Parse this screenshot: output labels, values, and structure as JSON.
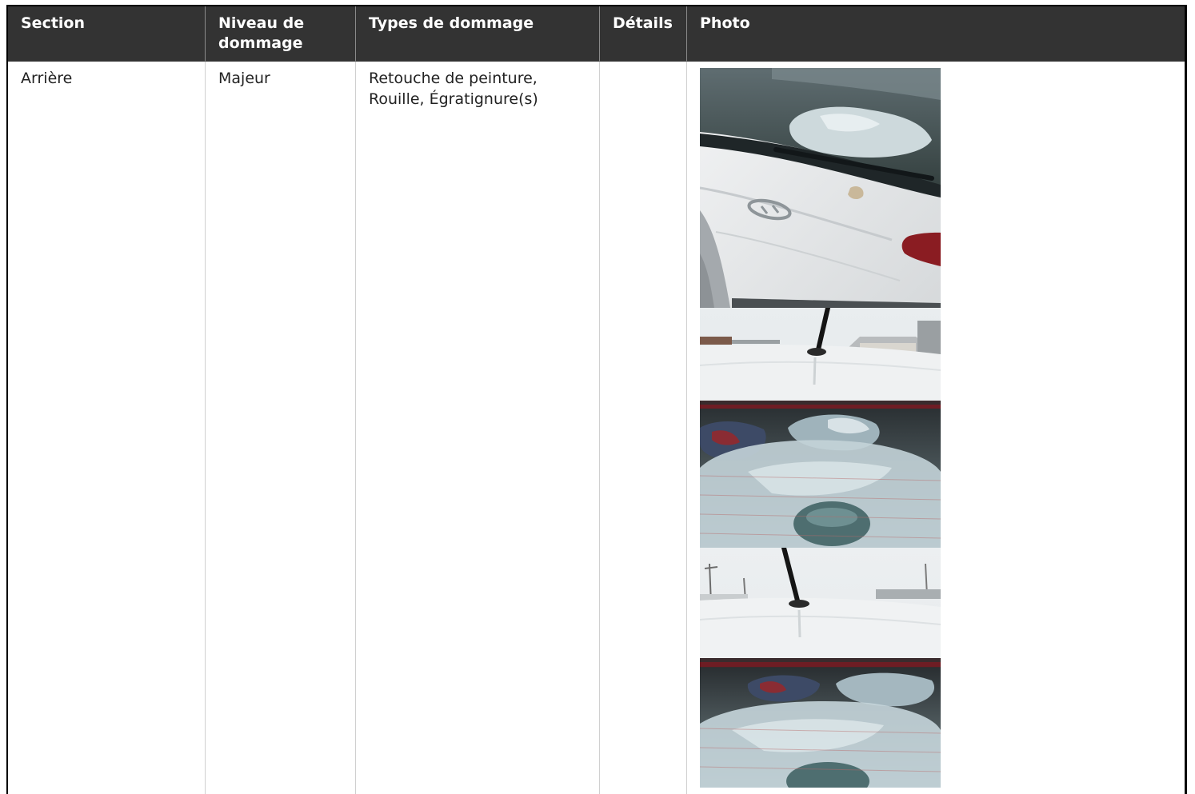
{
  "colors": {
    "header_bg": "#333333",
    "header_text": "#ffffff",
    "frame": "#000000",
    "grid_line": "#d0d0d0"
  },
  "table": {
    "headers": [
      "Section",
      "Niveau de dommage",
      "Types de dommage",
      "Détails",
      "Photo"
    ],
    "rows": [
      {
        "section": "Arrière",
        "damage_level": "Majeur",
        "damage_types": "Retouche de peinture, Rouille, Égratignure(s)",
        "details": ""
      }
    ]
  }
}
